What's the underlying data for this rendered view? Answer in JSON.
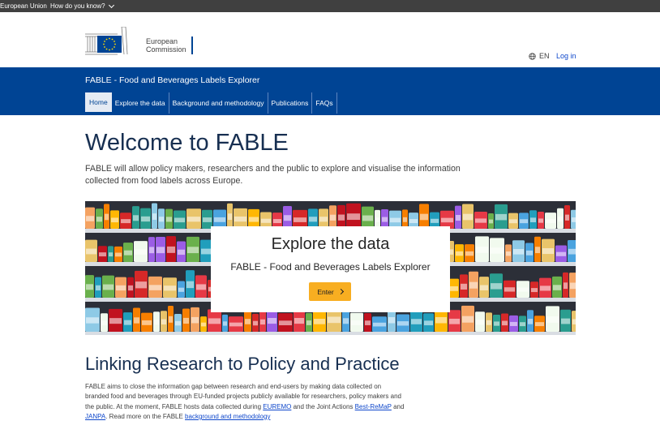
{
  "globan": {
    "eu_label": "European Union",
    "how_label": "How do you know?"
  },
  "header": {
    "logo_line1": "European",
    "logo_line2": "Commission",
    "lang": "EN",
    "login": "Log in"
  },
  "banner": {
    "site_name": "FABLE - Food and Beverages Labels Explorer",
    "nav": [
      "Home",
      "Explore the data",
      "Background and methodology",
      "Publications",
      "FAQs"
    ],
    "active_index": 0
  },
  "main": {
    "title": "Welcome to FABLE",
    "intro": "FABLE will allow policy makers, researchers and the public to explore and visualise the information collected from food labels across Europe.",
    "card": {
      "title": "Explore the data",
      "subtitle": "FABLE - Food and Beverages Labels Explorer",
      "button": "Enter"
    },
    "section_title": "Linking Research to Policy and Practice",
    "para": {
      "t1": "FABLE aims to close the information gap between research and end-users by making data collected on branded food and beverages through EU-funded projects publicly available for researchers, policy makers and the public. At the moment, FABLE hosts data collected during ",
      "link1": "EUREMO",
      "t2": " and the Joint Actions ",
      "link2": "Best-ReMaP",
      "t3": " and ",
      "link3": "JANPA",
      "t4": ". Read more on the FABLE ",
      "link4": "background and methodology"
    }
  },
  "colors": {
    "top_bar": "#404040",
    "banner": "#004494",
    "accent_button": "#f8ae21",
    "link": "#0e47cb",
    "heading": "#172f51"
  }
}
